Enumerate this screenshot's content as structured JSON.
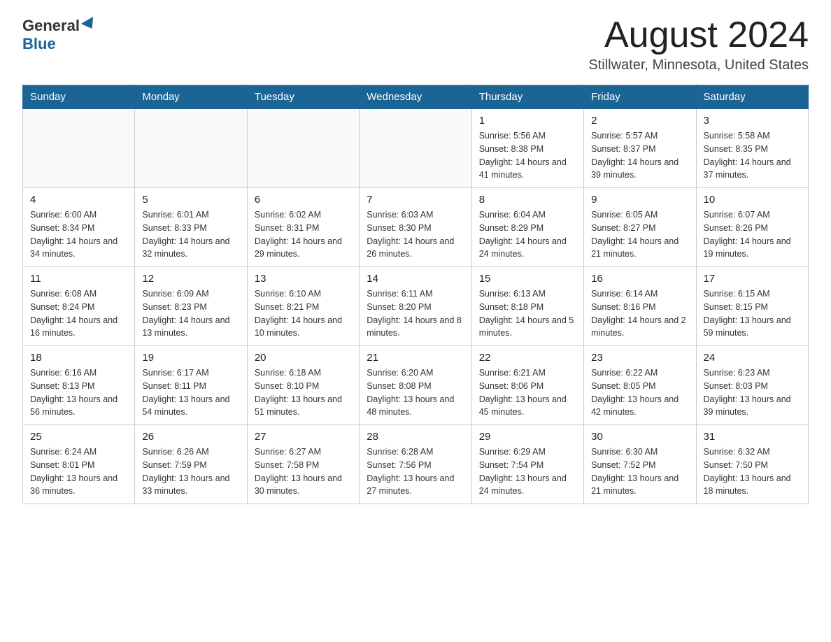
{
  "header": {
    "logo_general": "General",
    "logo_blue": "Blue",
    "month_title": "August 2024",
    "location": "Stillwater, Minnesota, United States"
  },
  "weekdays": [
    "Sunday",
    "Monday",
    "Tuesday",
    "Wednesday",
    "Thursday",
    "Friday",
    "Saturday"
  ],
  "weeks": [
    [
      {
        "day": "",
        "info": ""
      },
      {
        "day": "",
        "info": ""
      },
      {
        "day": "",
        "info": ""
      },
      {
        "day": "",
        "info": ""
      },
      {
        "day": "1",
        "info": "Sunrise: 5:56 AM\nSunset: 8:38 PM\nDaylight: 14 hours and 41 minutes."
      },
      {
        "day": "2",
        "info": "Sunrise: 5:57 AM\nSunset: 8:37 PM\nDaylight: 14 hours and 39 minutes."
      },
      {
        "day": "3",
        "info": "Sunrise: 5:58 AM\nSunset: 8:35 PM\nDaylight: 14 hours and 37 minutes."
      }
    ],
    [
      {
        "day": "4",
        "info": "Sunrise: 6:00 AM\nSunset: 8:34 PM\nDaylight: 14 hours and 34 minutes."
      },
      {
        "day": "5",
        "info": "Sunrise: 6:01 AM\nSunset: 8:33 PM\nDaylight: 14 hours and 32 minutes."
      },
      {
        "day": "6",
        "info": "Sunrise: 6:02 AM\nSunset: 8:31 PM\nDaylight: 14 hours and 29 minutes."
      },
      {
        "day": "7",
        "info": "Sunrise: 6:03 AM\nSunset: 8:30 PM\nDaylight: 14 hours and 26 minutes."
      },
      {
        "day": "8",
        "info": "Sunrise: 6:04 AM\nSunset: 8:29 PM\nDaylight: 14 hours and 24 minutes."
      },
      {
        "day": "9",
        "info": "Sunrise: 6:05 AM\nSunset: 8:27 PM\nDaylight: 14 hours and 21 minutes."
      },
      {
        "day": "10",
        "info": "Sunrise: 6:07 AM\nSunset: 8:26 PM\nDaylight: 14 hours and 19 minutes."
      }
    ],
    [
      {
        "day": "11",
        "info": "Sunrise: 6:08 AM\nSunset: 8:24 PM\nDaylight: 14 hours and 16 minutes."
      },
      {
        "day": "12",
        "info": "Sunrise: 6:09 AM\nSunset: 8:23 PM\nDaylight: 14 hours and 13 minutes."
      },
      {
        "day": "13",
        "info": "Sunrise: 6:10 AM\nSunset: 8:21 PM\nDaylight: 14 hours and 10 minutes."
      },
      {
        "day": "14",
        "info": "Sunrise: 6:11 AM\nSunset: 8:20 PM\nDaylight: 14 hours and 8 minutes."
      },
      {
        "day": "15",
        "info": "Sunrise: 6:13 AM\nSunset: 8:18 PM\nDaylight: 14 hours and 5 minutes."
      },
      {
        "day": "16",
        "info": "Sunrise: 6:14 AM\nSunset: 8:16 PM\nDaylight: 14 hours and 2 minutes."
      },
      {
        "day": "17",
        "info": "Sunrise: 6:15 AM\nSunset: 8:15 PM\nDaylight: 13 hours and 59 minutes."
      }
    ],
    [
      {
        "day": "18",
        "info": "Sunrise: 6:16 AM\nSunset: 8:13 PM\nDaylight: 13 hours and 56 minutes."
      },
      {
        "day": "19",
        "info": "Sunrise: 6:17 AM\nSunset: 8:11 PM\nDaylight: 13 hours and 54 minutes."
      },
      {
        "day": "20",
        "info": "Sunrise: 6:18 AM\nSunset: 8:10 PM\nDaylight: 13 hours and 51 minutes."
      },
      {
        "day": "21",
        "info": "Sunrise: 6:20 AM\nSunset: 8:08 PM\nDaylight: 13 hours and 48 minutes."
      },
      {
        "day": "22",
        "info": "Sunrise: 6:21 AM\nSunset: 8:06 PM\nDaylight: 13 hours and 45 minutes."
      },
      {
        "day": "23",
        "info": "Sunrise: 6:22 AM\nSunset: 8:05 PM\nDaylight: 13 hours and 42 minutes."
      },
      {
        "day": "24",
        "info": "Sunrise: 6:23 AM\nSunset: 8:03 PM\nDaylight: 13 hours and 39 minutes."
      }
    ],
    [
      {
        "day": "25",
        "info": "Sunrise: 6:24 AM\nSunset: 8:01 PM\nDaylight: 13 hours and 36 minutes."
      },
      {
        "day": "26",
        "info": "Sunrise: 6:26 AM\nSunset: 7:59 PM\nDaylight: 13 hours and 33 minutes."
      },
      {
        "day": "27",
        "info": "Sunrise: 6:27 AM\nSunset: 7:58 PM\nDaylight: 13 hours and 30 minutes."
      },
      {
        "day": "28",
        "info": "Sunrise: 6:28 AM\nSunset: 7:56 PM\nDaylight: 13 hours and 27 minutes."
      },
      {
        "day": "29",
        "info": "Sunrise: 6:29 AM\nSunset: 7:54 PM\nDaylight: 13 hours and 24 minutes."
      },
      {
        "day": "30",
        "info": "Sunrise: 6:30 AM\nSunset: 7:52 PM\nDaylight: 13 hours and 21 minutes."
      },
      {
        "day": "31",
        "info": "Sunrise: 6:32 AM\nSunset: 7:50 PM\nDaylight: 13 hours and 18 minutes."
      }
    ]
  ]
}
